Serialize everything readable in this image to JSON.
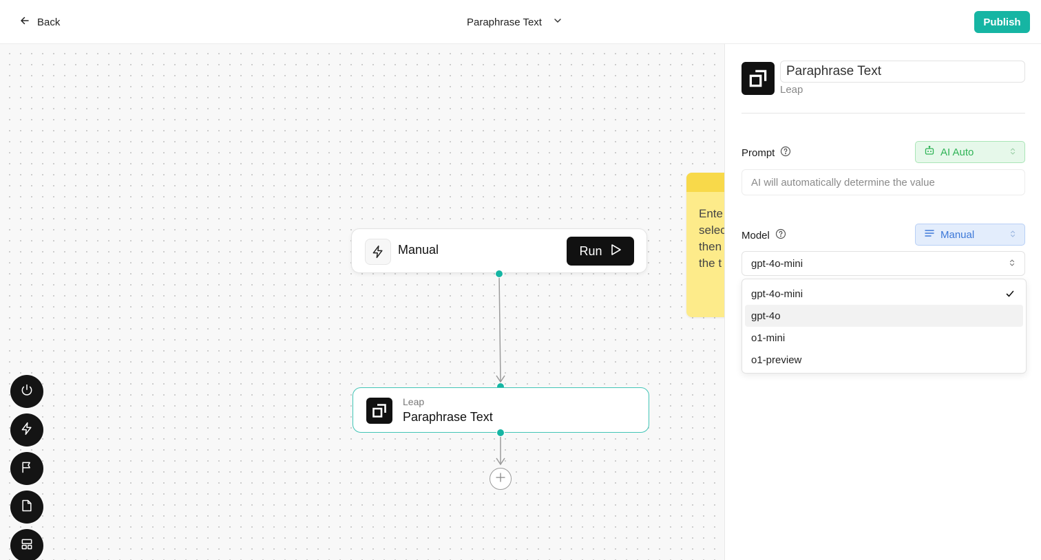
{
  "header": {
    "back_label": "Back",
    "workflow_title": "Paraphrase Text",
    "publish_label": "Publish"
  },
  "canvas": {
    "sticky_note_text": "Ente\nselec\nthen\nthe t",
    "manual_node": {
      "label": "Manual",
      "run_label": "Run",
      "icon": "lightning-icon"
    },
    "leap_node": {
      "app": "Leap",
      "title": "Paraphrase Text",
      "icon": "leap-logo"
    },
    "toolbar": [
      "power-icon",
      "lightning-icon",
      "flag-icon",
      "file-icon",
      "layout-icon"
    ]
  },
  "panel": {
    "name": "Paraphrase Text",
    "subtitle": "Leap",
    "prompt": {
      "label": "Prompt",
      "mode": "AI Auto",
      "value_placeholder": "AI will automatically determine the value"
    },
    "model": {
      "label": "Model",
      "mode": "Manual",
      "selected": "gpt-4o-mini",
      "options": [
        "gpt-4o-mini",
        "gpt-4o",
        "o1-mini",
        "o1-preview"
      ],
      "hovered_option": "gpt-4o"
    }
  },
  "colors": {
    "accent": "#16b5a3",
    "ai_green": "#2fb356",
    "manual_blue": "#3c78d8",
    "sticky": "#fdeb8a"
  }
}
